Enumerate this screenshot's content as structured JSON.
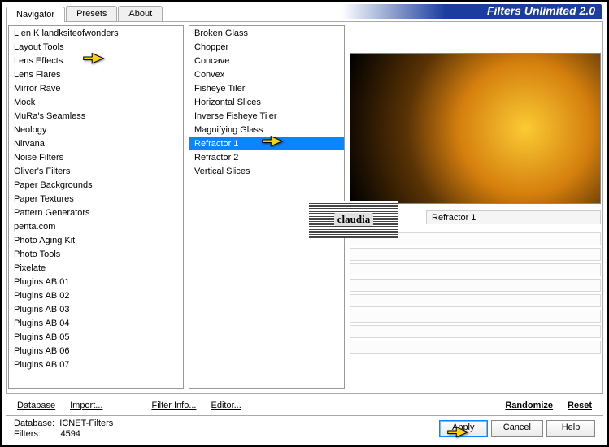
{
  "app_title": "Filters Unlimited 2.0",
  "tabs": [
    "Navigator",
    "Presets",
    "About"
  ],
  "active_tab": 0,
  "categories": [
    "L en K landksiteofwonders",
    "Layout Tools",
    "Lens Effects",
    "Lens Flares",
    "Mirror Rave",
    "Mock",
    "MuRa's Seamless",
    "Neology",
    "Nirvana",
    "Noise Filters",
    "Oliver's Filters",
    "Paper Backgrounds",
    "Paper Textures",
    "Pattern Generators",
    "penta.com",
    "Photo Aging Kit",
    "Photo Tools",
    "Pixelate",
    "Plugins AB 01",
    "Plugins AB 02",
    "Plugins AB 03",
    "Plugins AB 04",
    "Plugins AB 05",
    "Plugins AB 06",
    "Plugins AB 07"
  ],
  "filters": [
    "Broken Glass",
    "Chopper",
    "Concave",
    "Convex",
    "Fisheye Tiler",
    "Horizontal Slices",
    "Inverse Fisheye Tiler",
    "Magnifying Glass",
    "Refractor 1",
    "Refractor 2",
    "Vertical Slices"
  ],
  "selected_filter_index": 8,
  "selected_filter_name": "Refractor 1",
  "watermark_text": "claudia",
  "toolbar": {
    "database": "Database",
    "import": "Import...",
    "filter_info": "Filter Info...",
    "editor": "Editor...",
    "randomize": "Randomize",
    "reset": "Reset"
  },
  "status": {
    "db_label": "Database:",
    "db_name": "ICNET-Filters",
    "filters_label": "Filters:",
    "filters_count": "4594"
  },
  "buttons": {
    "apply": "Apply",
    "cancel": "Cancel",
    "help": "Help"
  }
}
